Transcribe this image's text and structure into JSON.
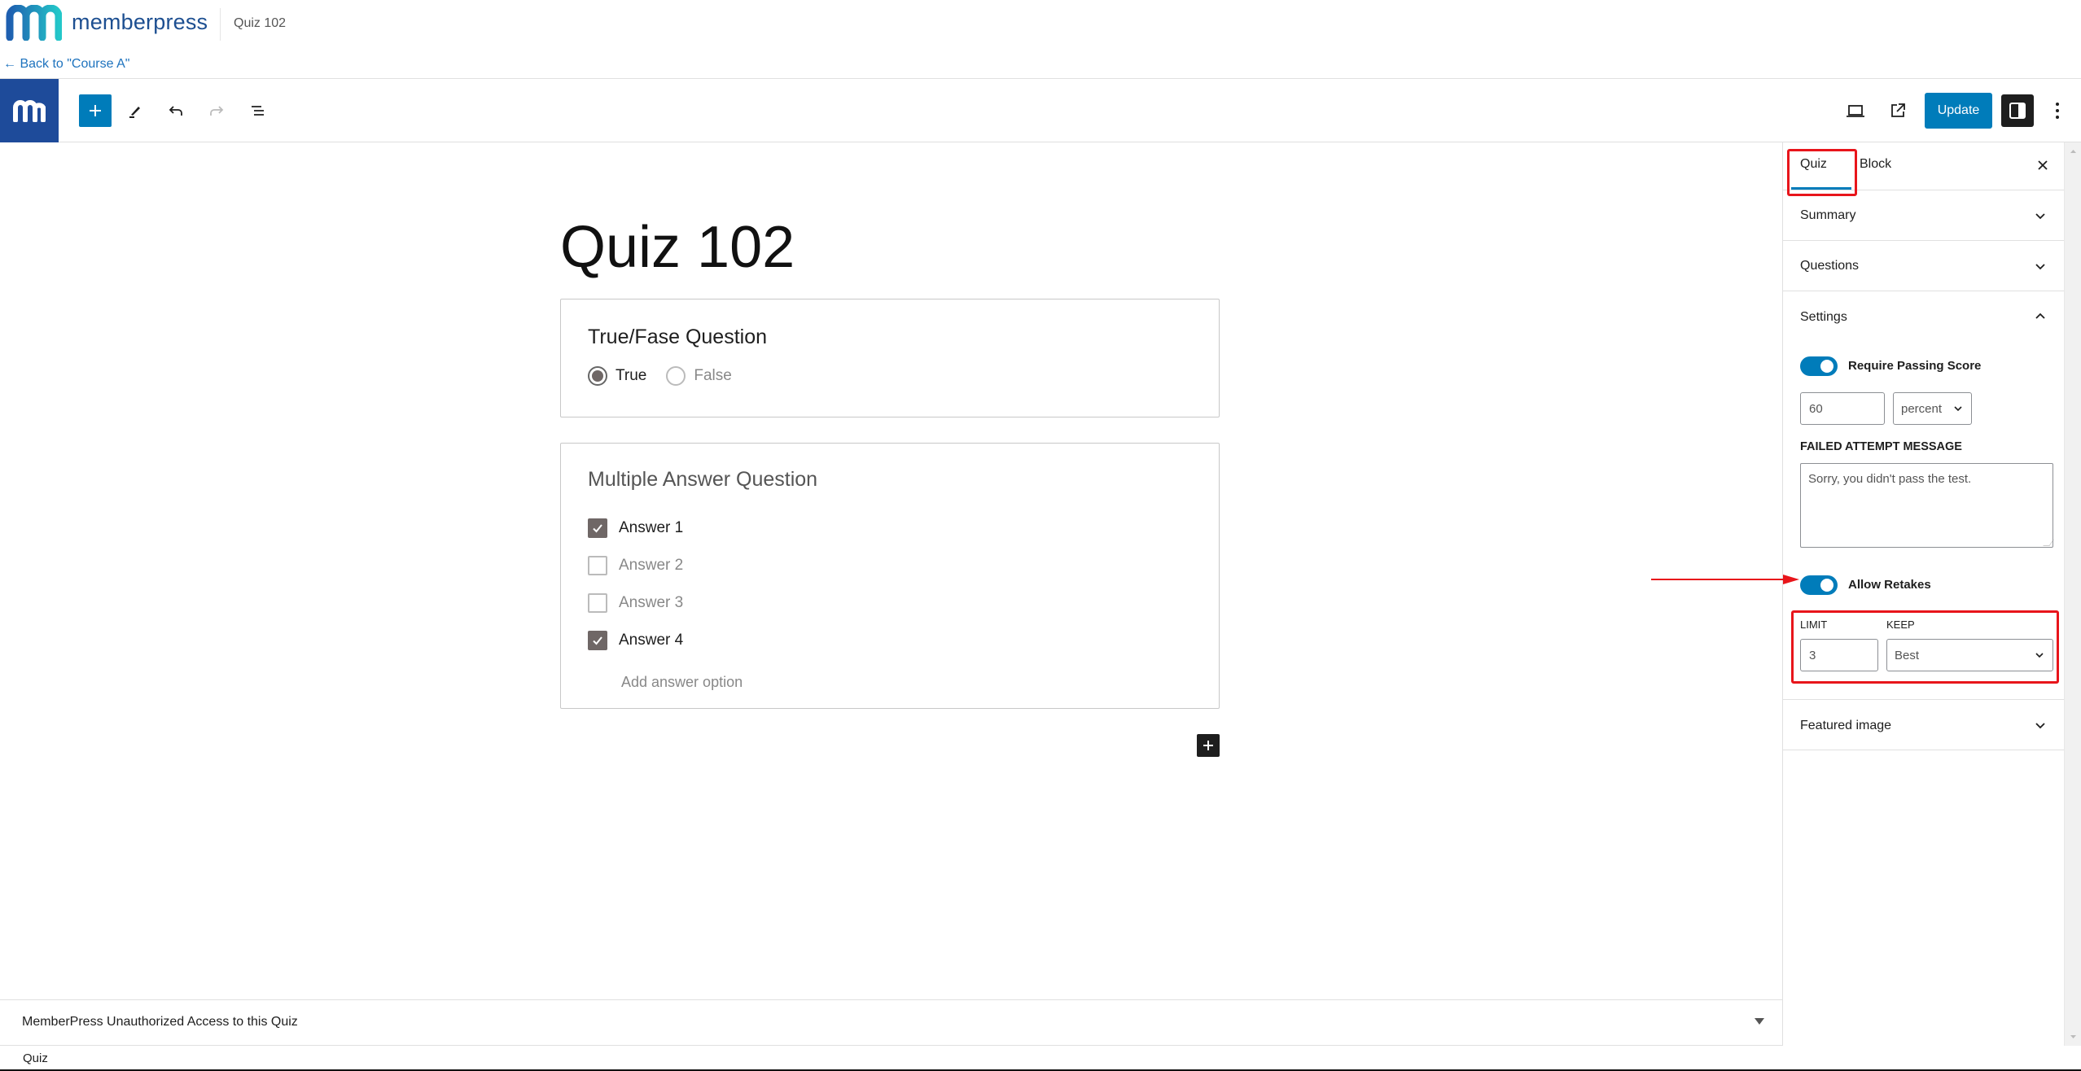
{
  "header": {
    "brand": "memberpress",
    "page_title": "Quiz 102",
    "back_link": "← Back to \"Course A\""
  },
  "toolbar": {
    "update_label": "Update",
    "icons": [
      "memberpress-logo-icon",
      "plus-icon",
      "pencil-icon",
      "undo-icon",
      "redo-icon",
      "list-view-icon",
      "preview-device-icon",
      "external-link-icon",
      "sidebar-toggle-icon",
      "more-vertical-icon"
    ]
  },
  "editor": {
    "post_title": "Quiz 102",
    "questions": [
      {
        "type": "true_false",
        "title": "True/Fase Question",
        "options": [
          {
            "label": "True",
            "selected": true
          },
          {
            "label": "False",
            "selected": false
          }
        ]
      },
      {
        "type": "multiple_answer",
        "title": "Multiple Answer Question",
        "answers": [
          {
            "label": "Answer 1",
            "checked": true
          },
          {
            "label": "Answer 2",
            "checked": false
          },
          {
            "label": "Answer 3",
            "checked": false
          },
          {
            "label": "Answer 4",
            "checked": true
          }
        ],
        "add_option_label": "Add answer option"
      }
    ]
  },
  "sidebar": {
    "tabs": [
      {
        "label": "Quiz",
        "active": true
      },
      {
        "label": "Block",
        "active": false
      }
    ],
    "panels": {
      "summary": "Summary",
      "questions": "Questions",
      "settings": "Settings",
      "featured_image": "Featured image"
    },
    "settings": {
      "require_passing_score_label": "Require Passing Score",
      "require_passing_score_on": true,
      "passing_score_value": "60",
      "passing_score_unit": "percent",
      "failed_attempt_label": "FAILED ATTEMPT MESSAGE",
      "failed_attempt_message": "Sorry, you didn't pass the test.",
      "allow_retakes_label": "Allow Retakes",
      "allow_retakes_on": true,
      "limit_label": "LIMIT",
      "limit_value": "3",
      "keep_label": "KEEP",
      "keep_value": "Best"
    }
  },
  "metabox": {
    "title": "MemberPress Unauthorized Access to this Quiz"
  },
  "footer": {
    "breadcrumb": "Quiz"
  },
  "colors": {
    "accent": "#007cba",
    "brand_dark": "#1e4b9a",
    "annotation_red": "#e8151b"
  }
}
